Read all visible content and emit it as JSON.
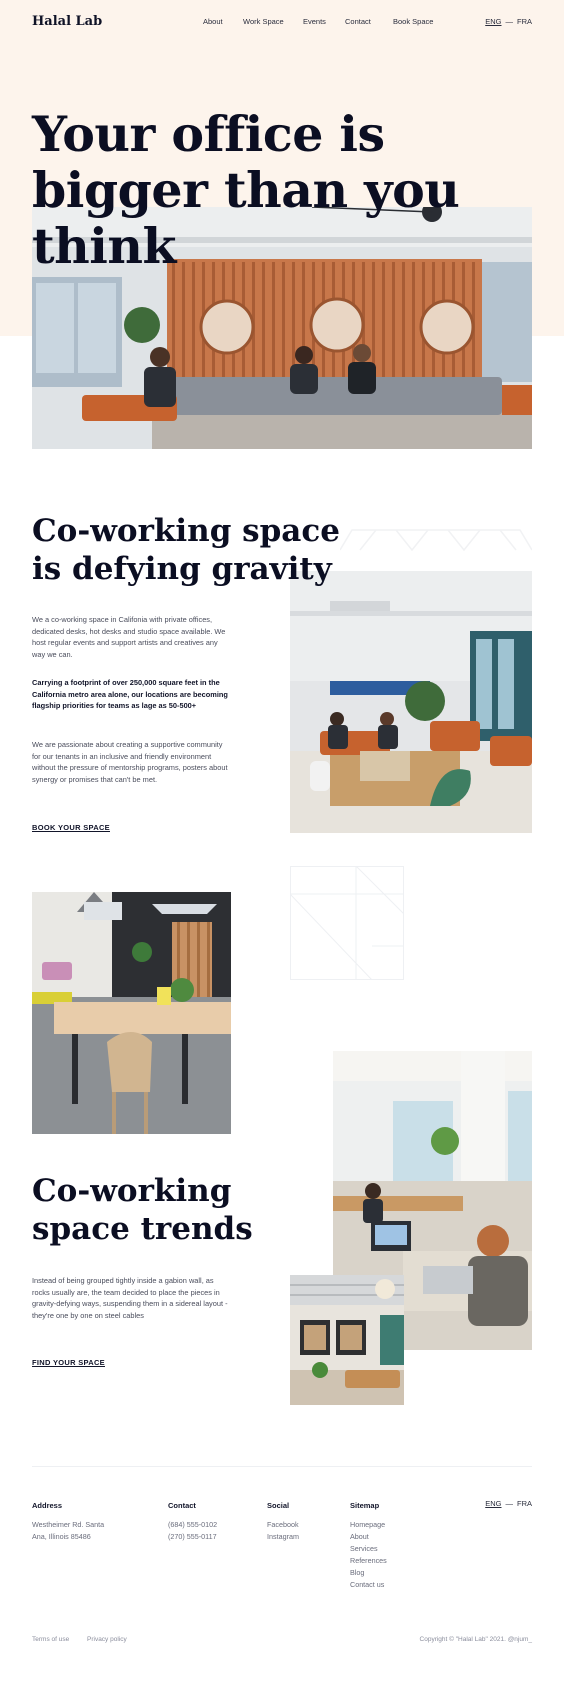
{
  "header": {
    "logo": "Halal Lab",
    "nav": [
      "About",
      "Work Space",
      "Events",
      "Contact",
      "Book Space"
    ],
    "lang_active": "ENG",
    "lang_sep": "—",
    "lang_other": "FRA"
  },
  "hero": {
    "title_line1": "Your office is",
    "title_line2": "bigger than you",
    "title_line3": "think"
  },
  "section1": {
    "title_line1": "Co-working space",
    "title_line2": "is defying gravity",
    "para1": "We a co-working space in Califonia with private offices, dedicated desks, hot desks and studio space available. We host regular events and support artists and creatives any way we can.",
    "para2": "Carrying a footprint of over 250,000 square feet in the California metro area alone, our locations are becoming flagship priorities for teams as lage as 50-500+",
    "para3": "We are passionate about creating a supportive community for our tenants in an inclusive and friendly environment without the pressure of mentorship programs, posters about synergy or promises that can't be met.",
    "cta": "BOOK YOUR SPACE"
  },
  "section2": {
    "title_line1": "Co-working",
    "title_line2": "space trends",
    "para": "Instead of being grouped tightly inside a gabion wall, as rocks usually are, the team decided to place the pieces in gravity-defying ways, suspending them in a sidereal layout - they're one by one on steel cables",
    "cta": "FIND YOUR SPACE"
  },
  "footer": {
    "address_head": "Address",
    "address_line1": "Westheimer Rd. Santa",
    "address_line2": "Ana, Illinois 85486",
    "contact_head": "Contact",
    "phone1": "(684) 555-0102",
    "phone2": "(270) 555-0117",
    "social_head": "Social",
    "social": [
      "Facebook",
      "Instagram"
    ],
    "sitemap_head": "Sitemap",
    "sitemap": [
      "Homepage",
      "About",
      "Services",
      "References",
      "Blog",
      "Contact us"
    ],
    "lang_active": "ENG",
    "lang_sep": "—",
    "lang_other": "FRA",
    "terms": "Terms of use",
    "privacy": "Privacy policy",
    "copyright": "Copyright © \"Halal Lab\" 2021. @njum_"
  },
  "colors": {
    "hero_bg": "#fdf4ec",
    "ink": "#0b0e22",
    "wood": "#c8774a",
    "sofa": "#8a9099"
  }
}
